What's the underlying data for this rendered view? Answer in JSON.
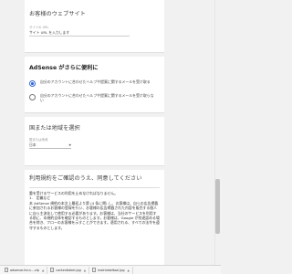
{
  "site_card": {
    "title": "お客様のウェブサイト",
    "field_label": "サイトの URL",
    "field_value": "サイト URL を入力します"
  },
  "adsense_card": {
    "title": "AdSense がさらに便利に",
    "options": [
      {
        "label": "自分のアカウントに合わせたヘルプや提案に関するメールを受け取る",
        "selected": true
      },
      {
        "label": "自分のアカウントに合わせたヘルプや提案に関するメールを受け取らない",
        "selected": false
      }
    ]
  },
  "region_card": {
    "title": "国または地域を選択",
    "select_label": "国または地域",
    "select_value": "日本"
  },
  "terms_card": {
    "title": "利用規約をご確認のうえ、同意してください",
    "paragraphs": [
      "重を受けるサービスの利用を止めなければなりません。",
      "1.　定義など",
      "本 AdSense 規約の本文上最初より第 (4 条に掲) し、お客様は、自らの広告掲載に参加されるお客様の登録を行い、お客様の広告掲載された内容を販売する個人に自ら主流化して使用する必要があります。お客様は、当社のサービスを利用する前に、本規約全体を確認するものとします。お客様は、Google が別途認める場合を除き、フローのお客様を示すことができます。適用される、すべての法令を遵守するものとします。"
    ]
  },
  "downloads": [
    {
      "name": "adsense-for-s....zip"
    },
    {
      "name": "contentlabel.jpg"
    },
    {
      "name": "mainlabeltool.jpg"
    }
  ]
}
